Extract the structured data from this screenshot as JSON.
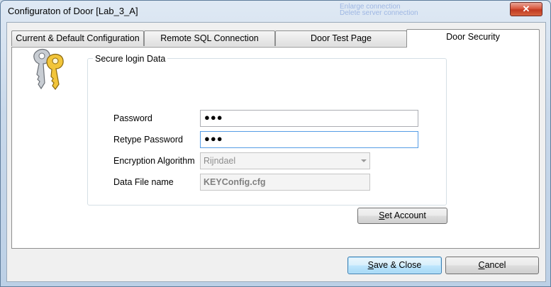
{
  "window": {
    "title": "Configuraton of Door [Lab_3_A]",
    "close_glyph": "✕",
    "ghost_lines": [
      "Enlarge connection",
      "Delete server connection"
    ]
  },
  "tabs": [
    {
      "label": "Current & Default Configuration",
      "active": false
    },
    {
      "label": "Remote SQL Connection",
      "active": false
    },
    {
      "label": "Door Test Page",
      "active": false
    },
    {
      "label": "Door Security",
      "active": true
    }
  ],
  "security": {
    "icon": "keys-icon",
    "group_title": "Secure login Data",
    "password_label": "Password",
    "password_value": "●●●",
    "retype_label": "Retype Password",
    "retype_value": "●●●",
    "algorithm_label": "Encryption Algorithm",
    "algorithm_value": "Rijndael",
    "datafile_label": "Data File name",
    "datafile_value": "KEYConfig.cfg",
    "set_account": {
      "mnemonic": "S",
      "rest": "et Account"
    }
  },
  "footer": {
    "save": {
      "mnemonic": "S",
      "rest": "ave & Close"
    },
    "cancel": {
      "mnemonic": "C",
      "rest": "ancel"
    }
  }
}
